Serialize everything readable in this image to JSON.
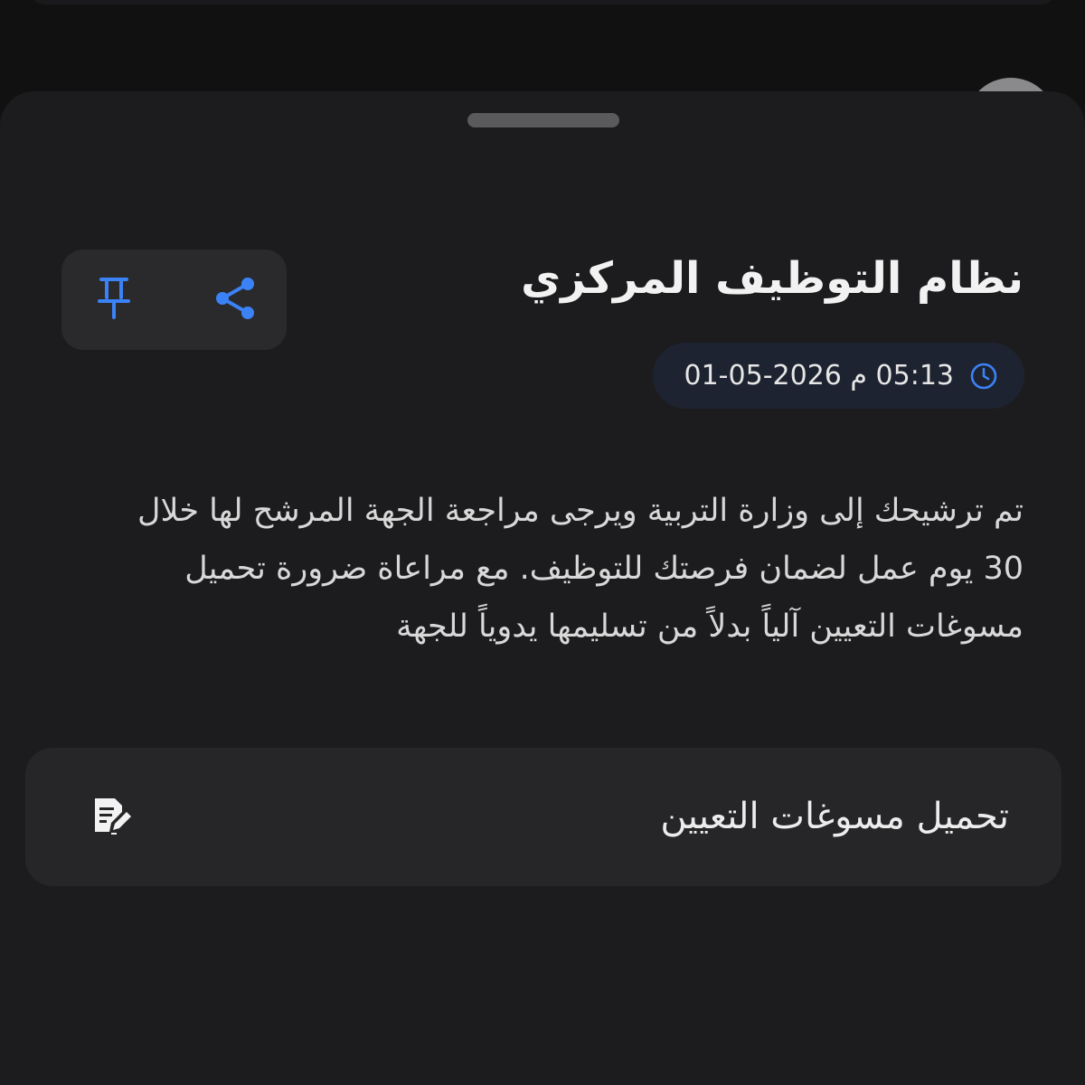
{
  "sheet": {
    "title": "نظام التوظيف المركزي",
    "date": "05:13 م 2026-05-01",
    "body": "تم ترشيحك إلى وزارة التربية ويرجى مراجعة الجهة المرشح لها خلال 30 يوم عمل لضمان فرصتك للتوظيف. مع مراعاة ضرورة تحميل مسوغات التعيين آلياً بدلاً من تسليمها يدوياً للجهة",
    "upload_label": "تحميل مسوغات التعيين"
  },
  "icons": {
    "pin": "pin-icon",
    "share": "share-icon",
    "clock": "clock-icon",
    "doc_edit": "document-edit-icon"
  },
  "colors": {
    "accent": "#3b82f6",
    "sheet_bg": "#1c1c1e",
    "pill_bg": "#1d2330"
  }
}
